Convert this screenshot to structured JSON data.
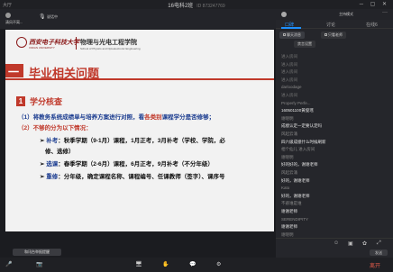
{
  "window": {
    "title": "16电科2班",
    "meeting_id": "ID 873247769",
    "top_left": "大厅",
    "controls": "─ ▢ ✕"
  },
  "participant": {
    "name": "清风不离...",
    "status": "说话中"
  },
  "right_header": {
    "mode": "主持模式",
    "more": "···"
  },
  "slide": {
    "logo_cn": "西安电子科技大学",
    "logo_en": "XIDIAN UNIVERSITY",
    "college_cn": "物理与光电工程学院",
    "college_en": "School of Physics and Optoelectronic Engineering",
    "title_dash": "一",
    "title": "毕业相关问题",
    "section_num": "1",
    "section_title": "学分核查",
    "line1_a": "（1）将教务系统成绩单与培养方案进行对照，看",
    "line1_red": "各类别",
    "line1_b": "课程学分是否修够；",
    "line2": "（2）不够的分为以下情况：",
    "b1_label": "补考",
    "b1_text": "：秋季学期（9-1月）课程，1月正考，3月补考（学校、学院，必",
    "b1_text2": "修、选修）",
    "b2_label": "选课",
    "b2_text": "：春季学期（2-6月）课程，6月正考，9月补考（不分年级）",
    "b3_label": "重修",
    "b3_text": "：分年级，确定课程名称、课程编号、任课教师（签字）、课序号"
  },
  "toast": "和讯台举报提醒",
  "bottombar": {
    "items": [
      "🎤",
      "📷",
      "🖥",
      "✋",
      "💬",
      "⚙"
    ],
    "labels": [
      "静音",
      "视频",
      "共享",
      "举手",
      "聊天",
      "设置"
    ],
    "leave": "离开"
  },
  "panel": {
    "tabs": [
      "口碑",
      "讨论",
      "在线6"
    ],
    "filters": [
      "聊天消息",
      "只看老师",
      "禁言设置"
    ],
    "messages": [
      {
        "type": "sys",
        "text": "进入房间"
      },
      {
        "type": "sys",
        "text": "进入房间"
      },
      {
        "type": "sys",
        "text": "进入房间"
      },
      {
        "type": "sys",
        "text": "进入房间"
      },
      {
        "type": "name",
        "text": "darloodage"
      },
      {
        "type": "sys",
        "text": "进入房间"
      },
      {
        "type": "name",
        "text": "Properly Perfe..."
      },
      {
        "type": "text",
        "text": "160501100黄俊瑶"
      },
      {
        "type": "name",
        "text": "谢晓明"
      },
      {
        "type": "text",
        "text": "成绩认定一定要认定吗"
      },
      {
        "type": "name",
        "text": "风起云涌"
      },
      {
        "type": "text",
        "text": "四六级成绩什么时候刷新"
      },
      {
        "type": "name",
        "text": "相个仙儿 进入房间"
      },
      {
        "type": "name",
        "text": "谢晓明"
      },
      {
        "type": "text",
        "text": "好的好的，谢谢老师"
      },
      {
        "type": "name",
        "text": "风起云涌"
      },
      {
        "type": "text",
        "text": "好的，谢谢老师"
      },
      {
        "type": "name",
        "text": "Kato"
      },
      {
        "type": "text",
        "text": "好的，谢谢老师"
      },
      {
        "type": "name",
        "text": "不惑谁是谁"
      },
      {
        "type": "text",
        "text": "谢谢老师"
      },
      {
        "type": "name",
        "text": "SERENDIPITY"
      },
      {
        "type": "text",
        "text": "谢谢老师"
      },
      {
        "type": "name",
        "text": "谢晓明"
      },
      {
        "type": "text",
        "text": "谢谢老师"
      }
    ],
    "send": "发送"
  }
}
